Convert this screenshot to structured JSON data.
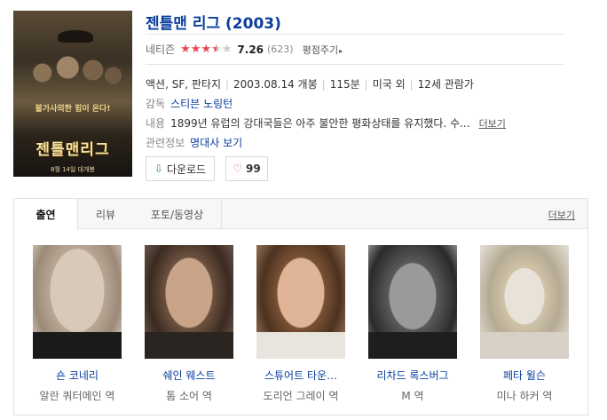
{
  "poster": {
    "tagline": "불가사의한 힘이 온다!",
    "title": "젠틀맨리그",
    "date": "8월 14일 대개봉"
  },
  "movie": {
    "title": "젠틀맨 리그 (2003)",
    "rating": {
      "source": "네티즌",
      "score": "7.26",
      "count": "(623)",
      "stars": 3.5,
      "rate_link": "평점주기"
    },
    "meta": {
      "genre": "액션, SF, 판타지",
      "release": "2003.08.14 개봉",
      "runtime": "115분",
      "country": "미국 외",
      "age": "12세 관람가"
    },
    "director": {
      "label": "감독",
      "name": "스티븐 노링턴"
    },
    "synopsis": {
      "label": "내용",
      "text": "1899년 유럽의 강대국들은 아주 불안한 평화상태를 유지했다. 수...",
      "more": "더보기"
    },
    "related": {
      "label": "관련정보",
      "link": "명대사 보기"
    }
  },
  "buttons": {
    "download": "다운로드",
    "like_count": "99"
  },
  "tabs": {
    "items": [
      "출연",
      "리뷰",
      "포토/동영상"
    ],
    "more": "더보기"
  },
  "cast": [
    {
      "name": "숀 코네리",
      "role": "알란 쿼터메인 역"
    },
    {
      "name": "쉐인 웨스트",
      "role": "톰 소어 역"
    },
    {
      "name": "스튜어트 타운…",
      "role": "도리언 그레이 역"
    },
    {
      "name": "리차드 록스버그",
      "role": "M 역"
    },
    {
      "name": "페타 윌슨",
      "role": "미나 하커 역"
    }
  ],
  "colors": {
    "link": "#0a3e9c",
    "star": "#e8474f",
    "download_icon": "#3aa655",
    "heart": "#e8474f"
  }
}
